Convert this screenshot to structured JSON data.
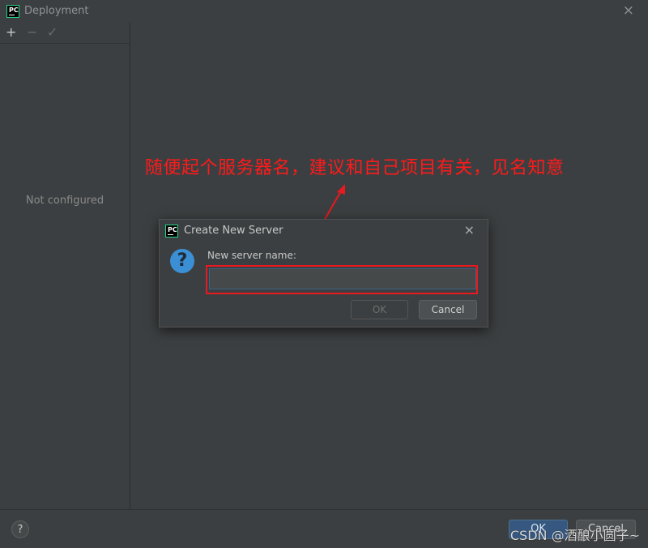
{
  "window": {
    "title": "Deployment",
    "logo_text": "PC",
    "close_icon": "×"
  },
  "toolbar": {
    "add_icon": "+",
    "remove_icon": "−",
    "apply_icon": "✓"
  },
  "left_panel": {
    "empty_text": "Not configured"
  },
  "footer": {
    "help_icon": "?",
    "ok_label": "OK",
    "cancel_label": "Cancel"
  },
  "watermark": "CSDN @酒酿小圆子~",
  "annotation": {
    "text": "随便起个服务器名，建议和自己项目有关，见名知意",
    "color": "#ff1a1a"
  },
  "dialog": {
    "title": "Create New Server",
    "logo_text": "PC",
    "close_icon": "×",
    "question_icon": "?",
    "field_label": "New server name:",
    "field_value": "",
    "ok_label": "OK",
    "cancel_label": "Cancel"
  },
  "colors": {
    "background": "#3c3f41",
    "accent": "#365880",
    "highlight": "#e8191f",
    "question": "#3b8fd4"
  }
}
